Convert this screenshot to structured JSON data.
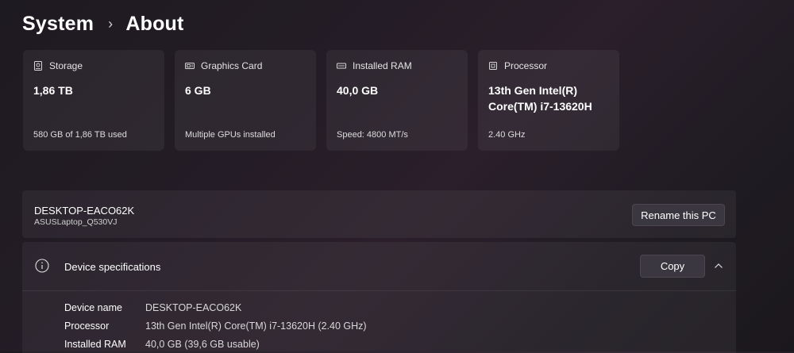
{
  "breadcrumb": {
    "parent": "System",
    "separator": "›",
    "current": "About"
  },
  "cards": [
    {
      "icon": "storage-icon",
      "title": "Storage",
      "value": "1,86 TB",
      "sub": "580 GB of 1,86 TB used"
    },
    {
      "icon": "graphics-card-icon",
      "title": "Graphics Card",
      "value": "6 GB",
      "sub": "Multiple GPUs installed"
    },
    {
      "icon": "ram-icon",
      "title": "Installed RAM",
      "value": "40,0 GB",
      "sub": "Speed: 4800 MT/s"
    },
    {
      "icon": "processor-icon",
      "title": "Processor",
      "value": "13th Gen Intel(R) Core(TM) i7-13620H",
      "sub": "2.40 GHz"
    }
  ],
  "pc": {
    "name": "DESKTOP-EACO62K",
    "model": "ASUSLaptop_Q530VJ",
    "rename_label": "Rename this PC"
  },
  "specs": {
    "title": "Device specifications",
    "copy_label": "Copy",
    "rows": [
      {
        "label": "Device name",
        "value": "DESKTOP-EACO62K"
      },
      {
        "label": "Processor",
        "value": "13th Gen Intel(R) Core(TM) i7-13620H (2.40 GHz)"
      },
      {
        "label": "Installed RAM",
        "value": "40,0 GB (39,6 GB usable)"
      }
    ]
  }
}
